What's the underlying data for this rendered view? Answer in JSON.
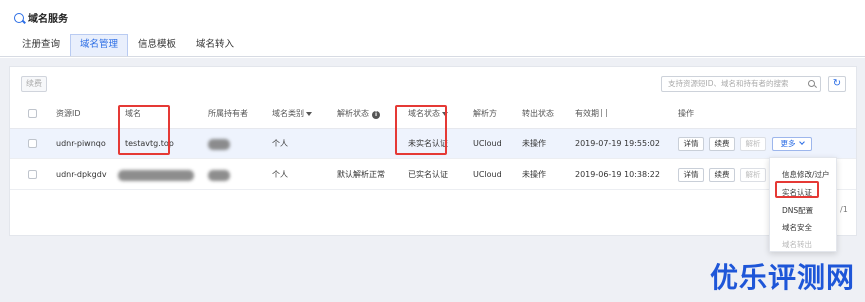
{
  "header": {
    "service_title": "域名服务"
  },
  "tabs": [
    {
      "label": "注册查询",
      "active": false
    },
    {
      "label": "域名管理",
      "active": true
    },
    {
      "label": "信息模板",
      "active": false
    },
    {
      "label": "域名转入",
      "active": false
    }
  ],
  "toolbar": {
    "renew_label": "续费",
    "search_placeholder": "支持资源短ID、域名和持有者的搜索",
    "refresh_icon": "refresh-icon"
  },
  "table": {
    "columns": [
      "资源ID",
      "域名",
      "所属持有者",
      "域名类别",
      "解析状态",
      "域名状态",
      "解析方",
      "转出状态",
      "有效期",
      "操作"
    ],
    "rows": [
      {
        "resource_id": "udnr-piwnqo",
        "domain": "testavtg.top",
        "holder": "",
        "category": "个人",
        "resolve_status": "",
        "domain_status": "未实名认证",
        "resolver": "UCloud",
        "transfer_status": "未操作",
        "expiry": "2019-07-19 19:55:02"
      },
      {
        "resource_id": "udnr-dpkgdv",
        "domain": "",
        "holder": "",
        "category": "个人",
        "resolve_status": "默认解析正常",
        "domain_status": "已实名认证",
        "resolver": "UCloud",
        "transfer_status": "未操作",
        "expiry": "2019-06-19 10:38:22"
      }
    ],
    "actions": {
      "detail": "详情",
      "renew": "续费",
      "resolve": "解析",
      "more": "更多"
    }
  },
  "more_menu": {
    "items": [
      {
        "label": "信息修改/过户",
        "disabled": false
      },
      {
        "label": "实名认证",
        "disabled": false
      },
      {
        "label": "DNS配置",
        "disabled": false
      },
      {
        "label": "域名安全",
        "disabled": false
      },
      {
        "label": "域名转出",
        "disabled": true
      }
    ]
  },
  "pagination_fragment": "/1",
  "watermark": "优乐评测网",
  "colors": {
    "accent": "#2b6de5",
    "highlight": "#e53935",
    "selected_row": "#eef3fd"
  }
}
